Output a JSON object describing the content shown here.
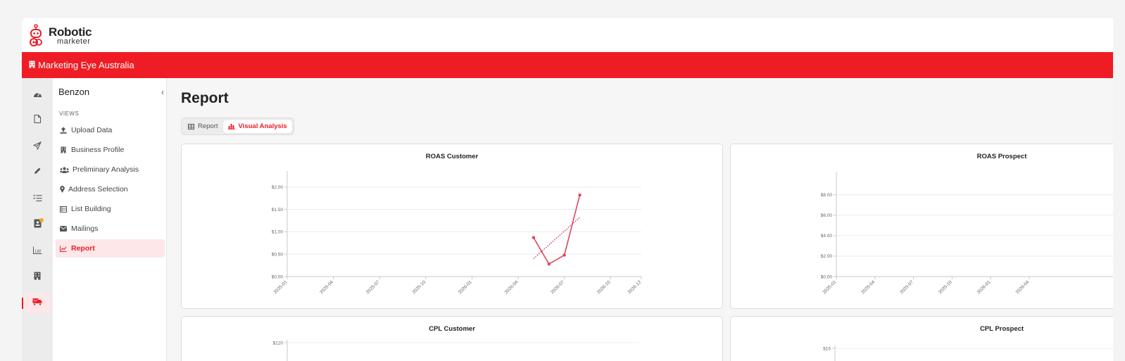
{
  "brand": {
    "name_line1": "Robotic",
    "name_line2": "marketer",
    "accent": "#ef1c25"
  },
  "org_bar": {
    "icon": "building-icon",
    "name": "Marketing Eye Australia"
  },
  "rail": [
    {
      "icon": "dashboard-icon"
    },
    {
      "icon": "document-icon"
    },
    {
      "icon": "send-icon"
    },
    {
      "icon": "pencil-icon"
    },
    {
      "icon": "checklist-icon"
    },
    {
      "icon": "contact-card-icon",
      "badge": true
    },
    {
      "icon": "chart-icon"
    },
    {
      "icon": "building-icon"
    },
    {
      "icon": "mail-truck-icon",
      "active": true
    }
  ],
  "sidenav": {
    "title": "Benzon",
    "collapse_icon": "chevron-left-icon",
    "section_label": "VIEWS",
    "items": [
      {
        "label": "Upload Data",
        "icon": "upload-icon"
      },
      {
        "label": "Business Profile",
        "icon": "building-icon"
      },
      {
        "label": "Preliminary Analysis",
        "icon": "users-icon"
      },
      {
        "label": "Address Selection",
        "icon": "map-pin-icon"
      },
      {
        "label": "List Building",
        "icon": "list-icon"
      },
      {
        "label": "Mailings",
        "icon": "envelope-icon"
      },
      {
        "label": "Report",
        "icon": "line-chart-icon",
        "active": true
      }
    ]
  },
  "main": {
    "title": "Report",
    "view_toggle": [
      {
        "label": "Report",
        "icon": "table-icon"
      },
      {
        "label": "Visual Analysis",
        "icon": "bar-chart-icon",
        "active": true
      }
    ]
  },
  "chart_data": [
    {
      "type": "line",
      "title": "ROAS Customer",
      "x_ticks": [
        "2025-01",
        "2025-04",
        "2025-07",
        "2025-10",
        "2026-01",
        "2026-04",
        "2026-07",
        "2026-10",
        "2026-12"
      ],
      "y_ticks": [
        "$0.00",
        "$0.50",
        "$1.00",
        "$1.50",
        "$2.00"
      ],
      "ylim": [
        0,
        2.2
      ],
      "series": [
        {
          "points": [
            [
              "2026-05",
              0.87
            ],
            [
              "2026-06",
              0.28
            ],
            [
              "2026-07",
              0.48
            ],
            [
              "2026-08",
              1.82
            ]
          ]
        }
      ],
      "trendline": {
        "points": [
          [
            "2026-05",
            0.4
          ],
          [
            "2026-08",
            1.32
          ]
        ],
        "style": "dotted"
      }
    },
    {
      "type": "line",
      "title": "ROAS Prospect",
      "x_ticks": [
        "2025-01",
        "2025-04",
        "2025-07",
        "2025-10",
        "2026-01",
        "2026-04"
      ],
      "y_ticks": [
        "$0.00",
        "$2.00",
        "$4.00",
        "$6.00",
        "$8.00"
      ],
      "ylim": [
        0,
        9.5
      ],
      "series": []
    },
    {
      "type": "line",
      "title": "CPL Customer",
      "y_ticks": [
        "$120"
      ],
      "series": []
    },
    {
      "type": "line",
      "title": "CPL Prospect",
      "y_ticks": [
        "$15"
      ],
      "series": []
    }
  ]
}
